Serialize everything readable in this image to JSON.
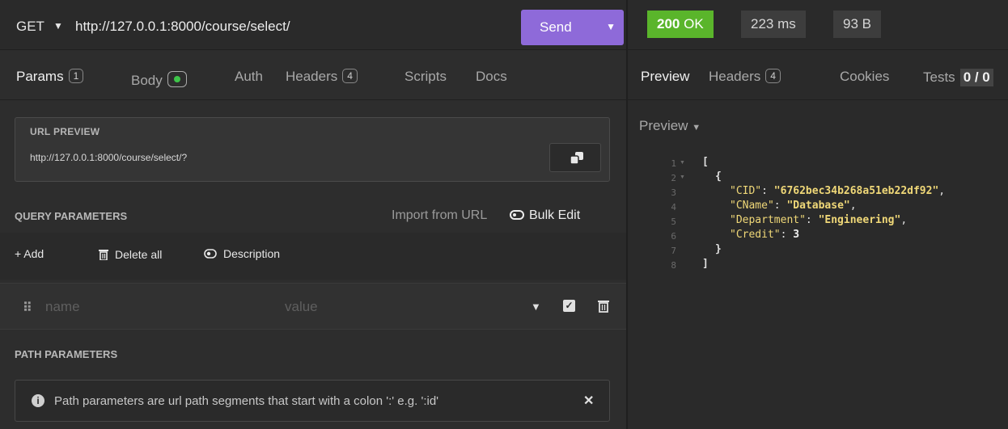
{
  "request": {
    "method": "GET",
    "url": "http://127.0.0.1:8000/course/select/",
    "send_label": "Send"
  },
  "tabs": [
    {
      "label": "Params",
      "badge": "1"
    },
    {
      "label": "Body"
    },
    {
      "label": "Auth"
    },
    {
      "label": "Headers",
      "badge": "4"
    },
    {
      "label": "Scripts"
    },
    {
      "label": "Docs"
    }
  ],
  "url_preview": {
    "title": "URL PREVIEW",
    "url": "http://127.0.0.1:8000/course/select/?"
  },
  "query": {
    "title": "QUERY PARAMETERS",
    "import_label": "Import from URL",
    "bulk_label": "Bulk Edit",
    "add_label": "+ Add",
    "delete_all_label": "Delete all",
    "description_label": "Description",
    "name_placeholder": "name",
    "value_placeholder": "value"
  },
  "path": {
    "title": "PATH PARAMETERS",
    "note": "Path parameters are url path segments that start with a colon ':' e.g. ':id'"
  },
  "response": {
    "status_code": "200",
    "status_text": "OK",
    "time": "223 ms",
    "size": "93 B",
    "status_color": "#5ab52b",
    "tabs": [
      {
        "label": "Preview"
      },
      {
        "label": "Headers",
        "badge": "4"
      },
      {
        "label": "Cookies"
      },
      {
        "label": "Tests",
        "badge": "0 / 0"
      }
    ],
    "preview_dropdown": "Preview",
    "line_numbers": [
      "1",
      "2",
      "3",
      "4",
      "5",
      "6",
      "7",
      "8"
    ],
    "body": {
      "open_bracket": "[",
      "open_brace": "{",
      "fields": [
        {
          "key": "\"CID\"",
          "value": "\"6762bec34b268a51eb22df92\"",
          "trail": ","
        },
        {
          "key": "\"CName\"",
          "value": "\"Database\"",
          "trail": ","
        },
        {
          "key": "\"Department\"",
          "value": "\"Engineering\"",
          "trail": ","
        },
        {
          "key": "\"Credit\"",
          "value": "3",
          "trail": ""
        }
      ],
      "close_brace": "}",
      "close_bracket": "]"
    }
  },
  "accent_color": "#8e6ad9"
}
